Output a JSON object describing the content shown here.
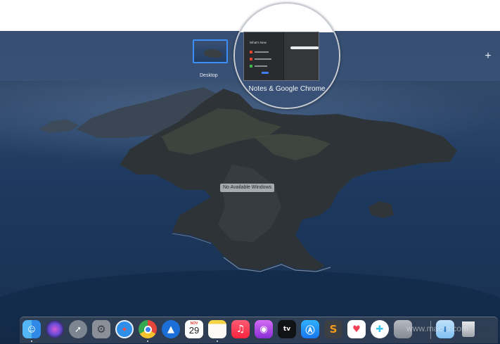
{
  "spaces": {
    "desktop_label": "Desktop",
    "app_space_label": "Notes & Google Chrome",
    "add_space_symbol": "+"
  },
  "magnifier": {
    "window_title": "What's New"
  },
  "desktop": {
    "no_windows_text": "No Available Windows"
  },
  "dock": {
    "calendar_month": "NOV",
    "calendar_day": "29",
    "tv_label": "tv",
    "icons": [
      "finder-icon",
      "siri-icon",
      "launchpad-icon",
      "system-preferences-icon",
      "safari-icon",
      "chrome-icon",
      "compass-icon",
      "calendar-icon",
      "notes-icon",
      "music-icon",
      "podcasts-icon",
      "apple-tv-icon",
      "app-store-icon",
      "sublime-text-icon",
      "pocket-icon",
      "slack-icon",
      "preview-icon",
      "downloads-folder-icon",
      "trash-icon"
    ]
  },
  "watermark": "www.macrb.com"
}
